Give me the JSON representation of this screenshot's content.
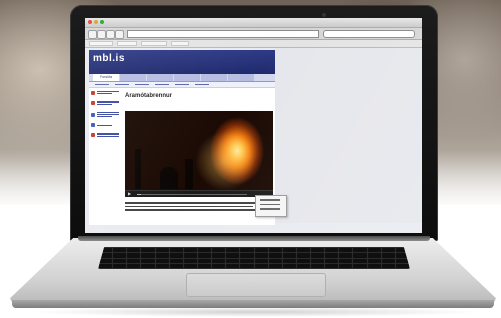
{
  "browser": {
    "window_title": "",
    "url": ""
  },
  "website": {
    "logo_text": "mbl.is",
    "nav_tabs": [
      "Forsíða",
      "",
      "",
      "",
      "",
      ""
    ],
    "active_tab": 0,
    "article_title": "Aramótabrennur",
    "video_progress_percent": 4
  },
  "colors": {
    "site_header": "#2e3a86",
    "laptop_bezel": "#111111",
    "laptop_body": "#d2d2d2"
  }
}
